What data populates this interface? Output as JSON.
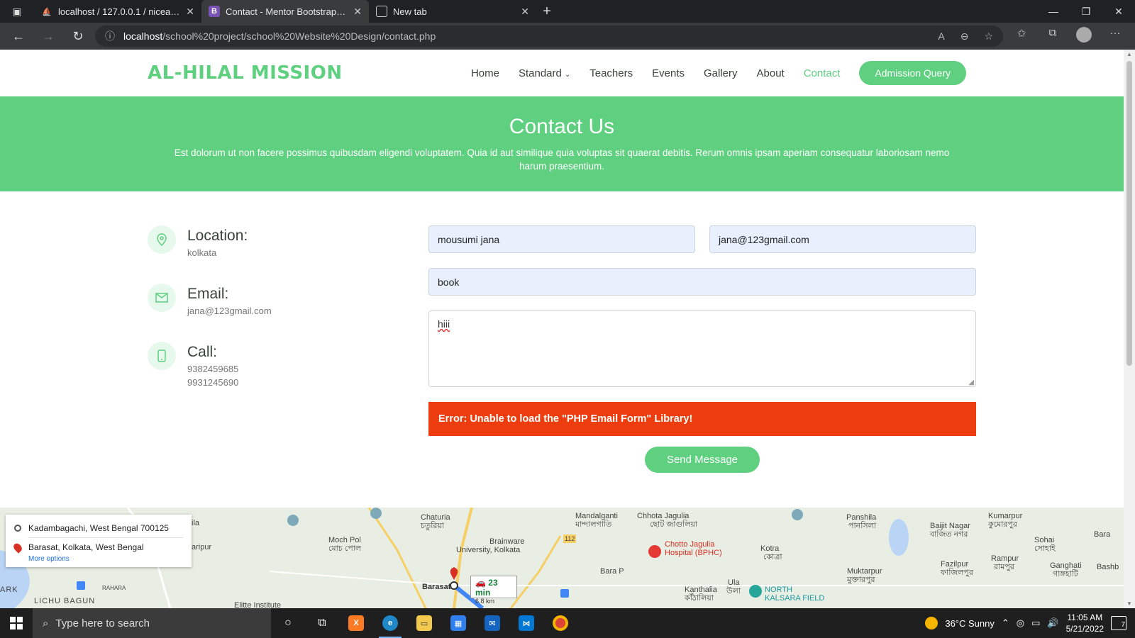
{
  "browser": {
    "tabs": [
      {
        "label": "localhost / 127.0.0.1 / niceadmin",
        "icon": "phpmyadmin-icon"
      },
      {
        "label": "Contact - Mentor Bootstrap Template",
        "icon": "bootstrap-icon"
      },
      {
        "label": "New tab",
        "icon": "newtab-icon"
      }
    ],
    "url_host": "localhost",
    "url_path": "/school%20project/school%20Website%20Design/contact.php"
  },
  "site": {
    "logo": "AL-HILAL MISSION",
    "nav": [
      "Home",
      "Standard",
      "Teachers",
      "Events",
      "Gallery",
      "About",
      "Contact"
    ],
    "active_nav": "Contact",
    "cta": "Admission Query",
    "accent_color": "#5fcf80"
  },
  "hero": {
    "title": "Contact Us",
    "text": "Est dolorum ut non facere possimus quibusdam eligendi voluptatem. Quia id aut similique quia voluptas sit quaerat debitis. Rerum omnis ipsam aperiam consequatur laboriosam nemo harum praesentium."
  },
  "info": {
    "location": {
      "title": "Location:",
      "text": "kolkata"
    },
    "email": {
      "title": "Email:",
      "text": "jana@123gmail.com"
    },
    "call": {
      "title": "Call:",
      "phone1": "9382459685",
      "phone2": "9931245690"
    }
  },
  "form": {
    "name": "mousumi jana",
    "email": "jana@123gmail.com",
    "subject": "book",
    "message": "hiii",
    "error": "Error: Unable to load the \"PHP Email Form\" Library!",
    "error_color": "#ed3c0d",
    "submit": "Send Message"
  },
  "map": {
    "from": "Kadambagachi, West Bengal 700125",
    "to": "Barasat, Kolkata, West Bengal",
    "more": "More options",
    "eta": "23 min",
    "distance": "6.8 km",
    "labels": {
      "chaturia": "Chaturia",
      "chaturia_bn": "চতুরিয়া",
      "mochpol": "Moch Pol",
      "mochpol_bn": "মোচ পোল",
      "brainware": "Brainware",
      "brainware2": "University, Kolkata",
      "mandalganti": "Mandalganti",
      "mandalganti_bn": "মান্দালগাতি",
      "chhotajagulia": "Chhota Jagulia",
      "chhotajagulia_bn": "ছোট জাগুলিয়া",
      "hospital1": "Chotto Jagulia",
      "hospital2": "Hospital (BPHC)",
      "kotra": "Kotra",
      "kotra_bn": "কোত্রা",
      "barap": "Bara P",
      "panshila": "Panshila",
      "panshila_bn": "পানসিলা",
      "baijitnagar": "Baijit Nagar",
      "baijitnagar_bn": "বাজিত নগর",
      "kumarpur": "Kumarpur",
      "kumarpur_bn": "কুমোরপুর",
      "sohai": "Sohai",
      "sohai_bn": "সোহাই",
      "fazilpur": "Fazilpur",
      "fazilpur_bn": "ফাজিলপুর",
      "rampur": "Rampur",
      "rampur_bn": "রামপুর",
      "ganghati": "Ganghati",
      "ganghati_bn": "গাঙ্গহাটি",
      "muktarpur": "Muktarpur",
      "muktarpur_bn": "মুক্তারপুর",
      "kanthalia": "Kanthalia",
      "kanthalia_bn": "কাঁঠালিয়া",
      "ula": "Ula",
      "ula_bn": "উলা",
      "northkalsara": "NORTH",
      "northkalsara2": "KALSARA FIELD",
      "barasat": "Barasat",
      "lichubagun": "LICHU BAGUN",
      "rahara": "RAHARA",
      "ark": "ARK",
      "ila": "ila",
      "aripur": "aripur",
      "elitte": "Elitte Institute",
      "bara": "Bara",
      "bashb": "Bashb",
      "road112": "112"
    }
  },
  "taskbar": {
    "search_placeholder": "Type here to search",
    "weather": "36°C  Sunny",
    "time": "11:05 AM",
    "date": "5/21/2022",
    "notifications": "7"
  }
}
